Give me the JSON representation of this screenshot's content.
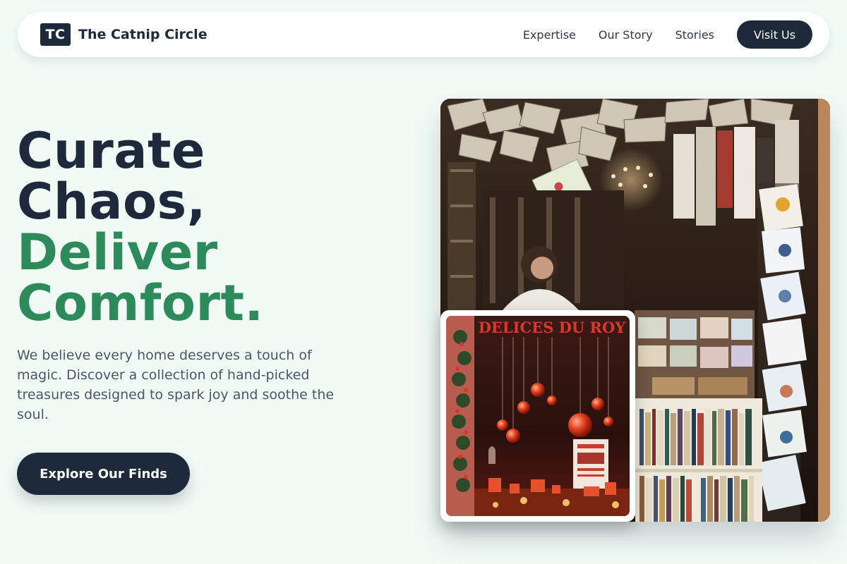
{
  "brand": {
    "logo_text": "TC",
    "name": "The Catnip Circle"
  },
  "nav": {
    "links": [
      {
        "label": "Expertise"
      },
      {
        "label": "Our Story"
      },
      {
        "label": "Stories"
      }
    ],
    "cta_label": "Visit Us"
  },
  "hero": {
    "headline_line1": "Curate",
    "headline_line2": "Chaos,",
    "headline_line3": "Deliver",
    "headline_line4": "Comfort.",
    "body": "We believe every home deserves a touch of magic. Discover a collection of hand-picked treasures designed to spark joy and soothe the soul.",
    "cta_label": "Explore Our Finds"
  },
  "images": {
    "main": {
      "icon": "bookshop-interior-photo"
    },
    "inset": {
      "icon": "shop-window-photo",
      "sign_text": "DELICES DU ROY"
    }
  },
  "colors": {
    "background": "#f1fbf6",
    "navy": "#1e2a3c",
    "green": "#2d8a5a",
    "body_text": "#4a5568"
  }
}
